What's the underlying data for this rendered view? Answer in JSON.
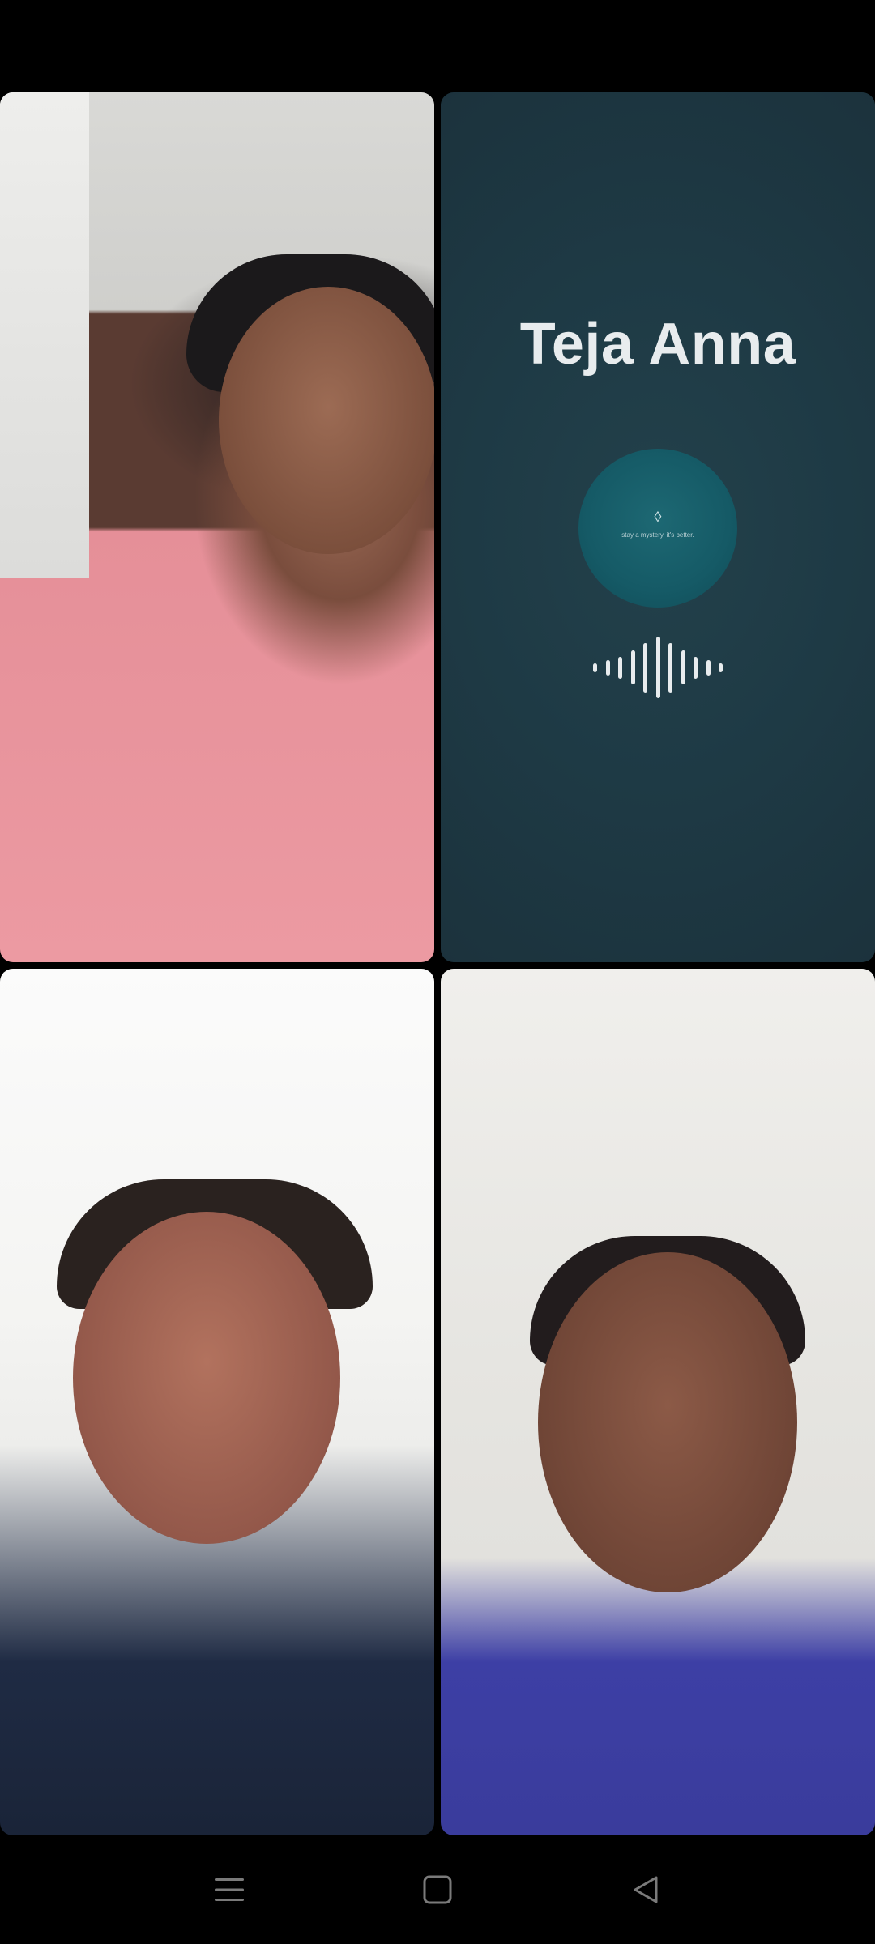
{
  "call": {
    "participants": [
      {
        "id": "p1",
        "type": "video"
      },
      {
        "id": "p2",
        "type": "audio",
        "name": "Teja Anna",
        "avatar_caption": "stay a mystery, it's better."
      },
      {
        "id": "p3",
        "type": "video"
      },
      {
        "id": "p4",
        "type": "video"
      }
    ]
  },
  "audio_wave_levels": [
    0.15,
    0.25,
    0.35,
    0.55,
    0.8,
    1.0,
    0.8,
    0.55,
    0.35,
    0.25,
    0.15
  ],
  "nav": {
    "menu_icon": "menu-lines-icon",
    "home_icon": "square-home-icon",
    "back_icon": "triangle-back-icon"
  },
  "colors": {
    "audio_tile_bg": "#1e3a45",
    "avatar_bg": "#155a66",
    "name_text": "#e8ecee",
    "nav_icon": "#7a7a7a"
  }
}
